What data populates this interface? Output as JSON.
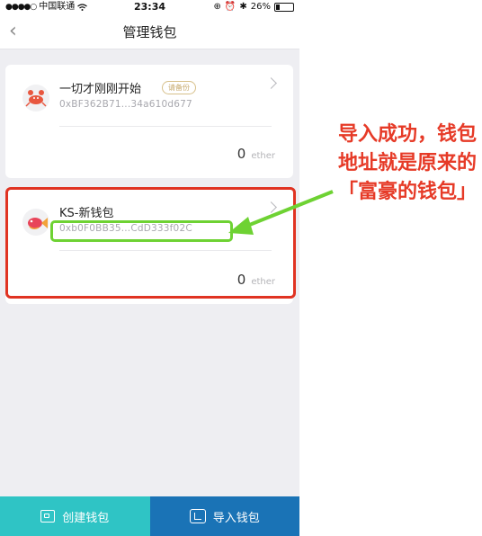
{
  "statusbar": {
    "carrier": "中国联通",
    "time": "23:34",
    "battery": "26%"
  },
  "navbar": {
    "title": "管理钱包"
  },
  "wallets": [
    {
      "name": "一切才刚刚开始",
      "badge": "请备份",
      "address": "0xBF362B71...34a610d677",
      "balance": "0",
      "unit": "ether"
    },
    {
      "name": "KS-新钱包",
      "address": "0xb0F0BB35...CdD333f02C",
      "balance": "0",
      "unit": "ether"
    }
  ],
  "annotation": {
    "text": "导入成功，钱包地址就是原来的「富豪的钱包」",
    "color": "#e63a27"
  },
  "bottombar": {
    "create_label": "创建钱包",
    "import_label": "导入钱包"
  },
  "colors": {
    "create_btn": "#2fc4c5",
    "import_btn": "#1a73b6",
    "highlight_red": "#e03322",
    "highlight_green": "#6ed233"
  }
}
